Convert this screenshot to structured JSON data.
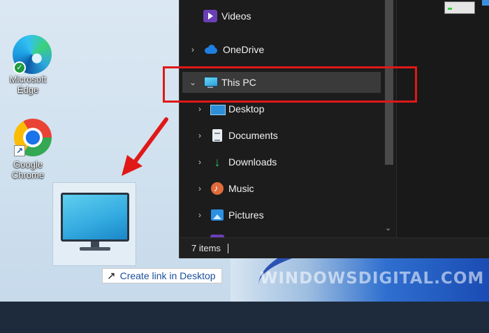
{
  "desktop": {
    "icons": [
      {
        "label_line1": "Microsoft",
        "label_line2": "Edge",
        "icon": "edge-icon"
      },
      {
        "label_line1": "Google",
        "label_line2": "Chrome",
        "icon": "chrome-icon"
      }
    ],
    "drag_tooltip": {
      "glyph": "↗",
      "text": "Create link in Desktop"
    }
  },
  "explorer": {
    "nav": [
      {
        "label": "Videos",
        "icon": "videos-icon",
        "chevron": ""
      },
      {
        "label": "OneDrive",
        "icon": "onedrive-icon",
        "chevron": "›"
      },
      {
        "label": "This PC",
        "icon": "this-pc-icon",
        "chevron": "⌄",
        "selected": true
      },
      {
        "label": "Desktop",
        "icon": "desktop-folder-icon",
        "chevron": "›"
      },
      {
        "label": "Documents",
        "icon": "documents-icon",
        "chevron": "›"
      },
      {
        "label": "Downloads",
        "icon": "downloads-icon",
        "chevron": "›"
      },
      {
        "label": "Music",
        "icon": "music-icon",
        "chevron": "›"
      },
      {
        "label": "Pictures",
        "icon": "pictures-icon",
        "chevron": "›"
      }
    ],
    "status": "7 items",
    "scroll_down_glyph": "⌄"
  },
  "watermark": "WINDOWSDIGITAL.COM",
  "colors": {
    "highlight": "#e01818",
    "selection": "#3a3a3a",
    "explorer_bg": "#202020"
  }
}
